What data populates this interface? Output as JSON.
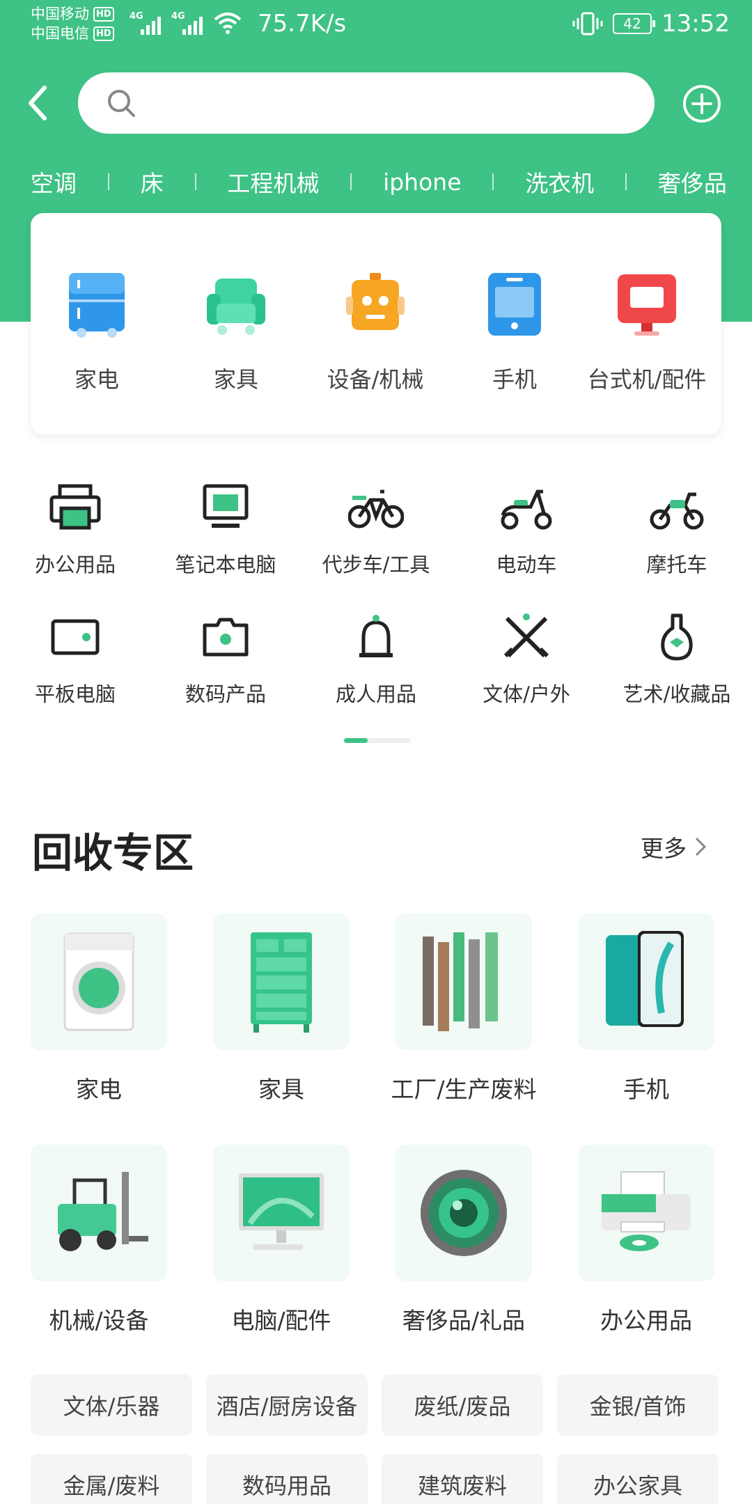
{
  "status_bar": {
    "carrier1": "中国移动",
    "carrier2": "中国电信",
    "hd": "HD",
    "network1": "4G",
    "network2": "4G",
    "speed": "75.7K/s",
    "battery": "42",
    "time": "13:52"
  },
  "header": {
    "search_placeholder": "",
    "hot_keywords": [
      "空调",
      "床",
      "工程机械",
      "iphone",
      "洗衣机",
      "奢侈品"
    ]
  },
  "main_categories": [
    {
      "label": "家电",
      "icon": "fridge-icon"
    },
    {
      "label": "家具",
      "icon": "sofa-icon"
    },
    {
      "label": "设备/机械",
      "icon": "robot-icon"
    },
    {
      "label": "手机",
      "icon": "phone-icon"
    },
    {
      "label": "台式机/配件",
      "icon": "monitor-icon"
    }
  ],
  "sub_categories": [
    {
      "label": "办公用品",
      "icon": "printer-icon"
    },
    {
      "label": "笔记本电脑",
      "icon": "laptop-icon"
    },
    {
      "label": "代步车/工具",
      "icon": "bicycle-icon"
    },
    {
      "label": "电动车",
      "icon": "scooter-icon"
    },
    {
      "label": "摩托车",
      "icon": "motorcycle-icon"
    },
    {
      "label": "平板电脑",
      "icon": "tablet-icon"
    },
    {
      "label": "数码产品",
      "icon": "camera-icon"
    },
    {
      "label": "成人用品",
      "icon": "bell-icon"
    },
    {
      "label": "文体/户外",
      "icon": "swords-icon"
    },
    {
      "label": "艺术/收藏品",
      "icon": "vase-icon"
    }
  ],
  "pager": {
    "active_fraction": 0.35
  },
  "recycle": {
    "title": "回收专区",
    "more": "更多",
    "items": [
      {
        "label": "家电",
        "icon": "washing-machine-image"
      },
      {
        "label": "家具",
        "icon": "cabinet-image"
      },
      {
        "label": "工厂/生产废料",
        "icon": "wood-planks-image"
      },
      {
        "label": "手机",
        "icon": "smartphone-image"
      },
      {
        "label": "机械/设备",
        "icon": "forklift-image"
      },
      {
        "label": "电脑/配件",
        "icon": "desktop-image"
      },
      {
        "label": "奢侈品/礼品",
        "icon": "lens-image"
      },
      {
        "label": "办公用品",
        "icon": "printer-image"
      }
    ],
    "tags": [
      "文体/乐器",
      "酒店/厨房设备",
      "废纸/废品",
      "金银/首饰",
      "金属/废料",
      "数码用品",
      "建筑废料",
      "办公家具"
    ]
  },
  "colors": {
    "accent": "#3ec285"
  }
}
